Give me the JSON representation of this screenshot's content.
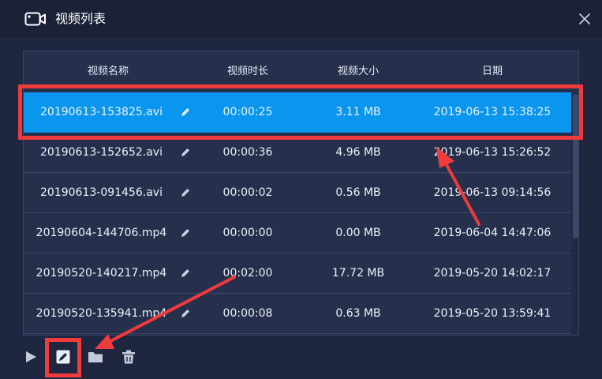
{
  "window": {
    "title": "视频列表",
    "title_icon": "video-camera-icon",
    "close_icon": "close-icon"
  },
  "table": {
    "columns": [
      "视频名称",
      "视频时长",
      "视频大小",
      "日期"
    ],
    "rows": [
      {
        "name": "20190613-153825.avi",
        "duration": "00:00:25",
        "size": "3.11 MB",
        "date": "2019-06-13 15:38:25",
        "selected": true
      },
      {
        "name": "20190613-152652.avi",
        "duration": "00:00:36",
        "size": "4.96 MB",
        "date": "2019-06-13 15:26:52",
        "selected": false
      },
      {
        "name": "20190613-091456.avi",
        "duration": "00:00:02",
        "size": "0.56 MB",
        "date": "2019-06-13 09:14:56",
        "selected": false
      },
      {
        "name": "20190604-144706.mp4",
        "duration": "00:00:00",
        "size": "0.00 MB",
        "date": "2019-06-04 14:47:06",
        "selected": false
      },
      {
        "name": "20190520-140217.mp4",
        "duration": "00:02:00",
        "size": "17.72 MB",
        "date": "2019-05-20 14:02:17",
        "selected": false
      },
      {
        "name": "20190520-135941.mp4",
        "duration": "00:00:08",
        "size": "0.63 MB",
        "date": "2019-05-20 13:59:41",
        "selected": false
      }
    ],
    "row_edit_icon": "pencil-icon"
  },
  "toolbar": {
    "icons": [
      "play-icon",
      "edit-icon",
      "folder-icon",
      "trash-icon"
    ]
  },
  "colors": {
    "selected_row": "#0a96ee",
    "highlight": "#ef3b3b",
    "background": "#1f2740",
    "titlebar": "#1b2238"
  }
}
